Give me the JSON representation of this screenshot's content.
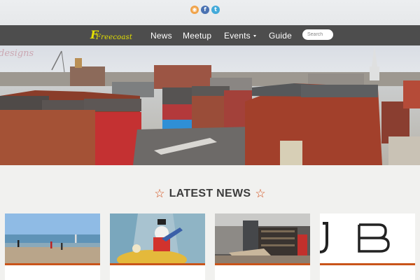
{
  "social": {
    "icons": [
      {
        "name": "rss-icon",
        "glyph": "◉",
        "color": "#f0a34a"
      },
      {
        "name": "facebook-icon",
        "glyph": "f",
        "color": "#4a72b2"
      },
      {
        "name": "twitter-icon",
        "glyph": "t",
        "color": "#42a9d9"
      }
    ]
  },
  "nav": {
    "logo_text": "Freecoast",
    "items": [
      "News",
      "Meetup",
      "Events",
      "Guide"
    ],
    "search_placeholder": "Search"
  },
  "hero": {
    "watermark": "designs"
  },
  "latest": {
    "heading": "LATEST NEWS",
    "star_glyph": "☆"
  },
  "cards": [
    {
      "title": ""
    },
    {
      "title": ""
    },
    {
      "title": ""
    },
    {
      "title": ""
    }
  ],
  "colors": {
    "accent": "#c9541a",
    "nav_bg": "#4d4d4d",
    "logo": "#e4e000"
  }
}
